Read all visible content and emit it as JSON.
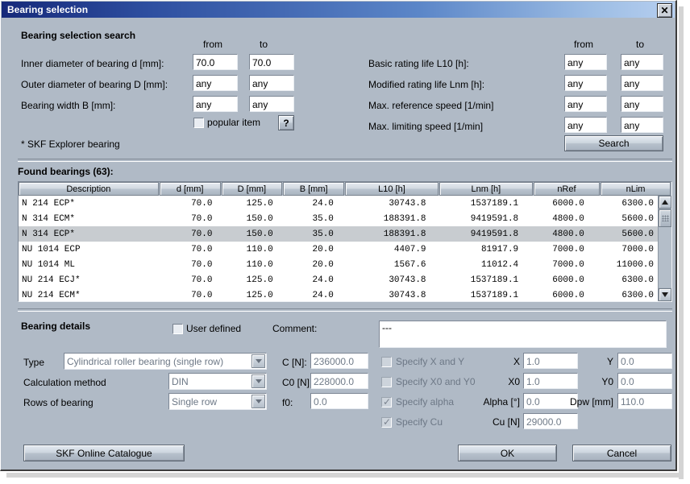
{
  "window": {
    "title": "Bearing selection",
    "close_label": "✕"
  },
  "search_section": {
    "heading": "Bearing selection search",
    "col_from": "from",
    "col_to": "to",
    "left_rows": [
      {
        "label": "Inner diameter of bearing d [mm]:",
        "from": "70.0",
        "to": "70.0"
      },
      {
        "label": "Outer diameter of bearing D [mm]:",
        "from": "any",
        "to": "any"
      },
      {
        "label": "Bearing width B [mm]:",
        "from": "any",
        "to": "any"
      }
    ],
    "right_col_from": "from",
    "right_col_to": "to",
    "right_rows": [
      {
        "label": "Basic rating life L10 [h]:",
        "from": "any",
        "to": "any"
      },
      {
        "label": "Modified rating life Lnm [h]:",
        "from": "any",
        "to": "any"
      },
      {
        "label": "Max. reference speed [1/min]",
        "from": "any",
        "to": "any"
      },
      {
        "label": "Max. limiting speed [1/min]",
        "from": "any",
        "to": "any"
      }
    ],
    "popular_item_label": "popular item",
    "help_label": "?",
    "search_label": "Search",
    "footnote": "* SKF Explorer bearing"
  },
  "results": {
    "heading": "Found bearings (63):",
    "columns": [
      "Description",
      "d [mm]",
      "D [mm]",
      "B [mm]",
      "L10 [h]",
      "Lnm [h]",
      "nRef",
      "nLim"
    ],
    "rows": [
      {
        "description": "N  214  ECP*",
        "d": "70.0",
        "D": "125.0",
        "B": "24.0",
        "L10": "30743.8",
        "Lnm": "1537189.1",
        "nRef": "6000.0",
        "nLim": "6300.0",
        "selected": false
      },
      {
        "description": "N  314  ECM*",
        "d": "70.0",
        "D": "150.0",
        "B": "35.0",
        "L10": "188391.8",
        "Lnm": "9419591.8",
        "nRef": "4800.0",
        "nLim": "5600.0",
        "selected": false
      },
      {
        "description": "N  314  ECP*",
        "d": "70.0",
        "D": "150.0",
        "B": "35.0",
        "L10": "188391.8",
        "Lnm": "9419591.8",
        "nRef": "4800.0",
        "nLim": "5600.0",
        "selected": true
      },
      {
        "description": "NU 1014  ECP",
        "d": "70.0",
        "D": "110.0",
        "B": "20.0",
        "L10": "4407.9",
        "Lnm": "81917.9",
        "nRef": "7000.0",
        "nLim": "7000.0",
        "selected": false
      },
      {
        "description": "NU 1014  ML",
        "d": "70.0",
        "D": "110.0",
        "B": "20.0",
        "L10": "1567.6",
        "Lnm": "11012.4",
        "nRef": "7000.0",
        "nLim": "11000.0",
        "selected": false
      },
      {
        "description": "NU 214  ECJ*",
        "d": "70.0",
        "D": "125.0",
        "B": "24.0",
        "L10": "30743.8",
        "Lnm": "1537189.1",
        "nRef": "6000.0",
        "nLim": "6300.0",
        "selected": false
      },
      {
        "description": "NU 214  ECM*",
        "d": "70.0",
        "D": "125.0",
        "B": "24.0",
        "L10": "30743.8",
        "Lnm": "1537189.1",
        "nRef": "6000.0",
        "nLim": "6300.0",
        "selected": false
      }
    ]
  },
  "details": {
    "heading": "Bearing details",
    "user_defined_label": "User defined",
    "comment_label": "Comment:",
    "comment_value": "---",
    "type_label": "Type",
    "type_value": "Cylindrical roller bearing (single row)",
    "calc_label": "Calculation method",
    "calc_value": "DIN",
    "rows_label": "Rows of bearing",
    "rows_value": "Single row",
    "c_label": "C [N]:",
    "c_value": "236000.0",
    "c0_label": "C0 [N]:",
    "c0_value": "228000.0",
    "f0_label": "f0:",
    "f0_value": "0.0",
    "specify_xy_label": "Specify X and Y",
    "specify_x0y0_label": "Specify X0 and Y0",
    "specify_alpha_label": "Specify alpha",
    "specify_cu_label": "Specify Cu",
    "x_label": "X",
    "x_value": "1.0",
    "y_label": "Y",
    "y_value": "0.0",
    "x0_label": "X0",
    "x0_value": "1.0",
    "y0_label": "Y0",
    "y0_value": "0.0",
    "alpha_label": "Alpha [°]",
    "alpha_value": "0.0",
    "dpw_label": "Dpw [mm]",
    "dpw_value": "110.0",
    "cu_label": "Cu [N]",
    "cu_value": "29000.0"
  },
  "footer": {
    "catalogue_label": "SKF Online Catalogue",
    "ok_label": "OK",
    "cancel_label": "Cancel"
  }
}
